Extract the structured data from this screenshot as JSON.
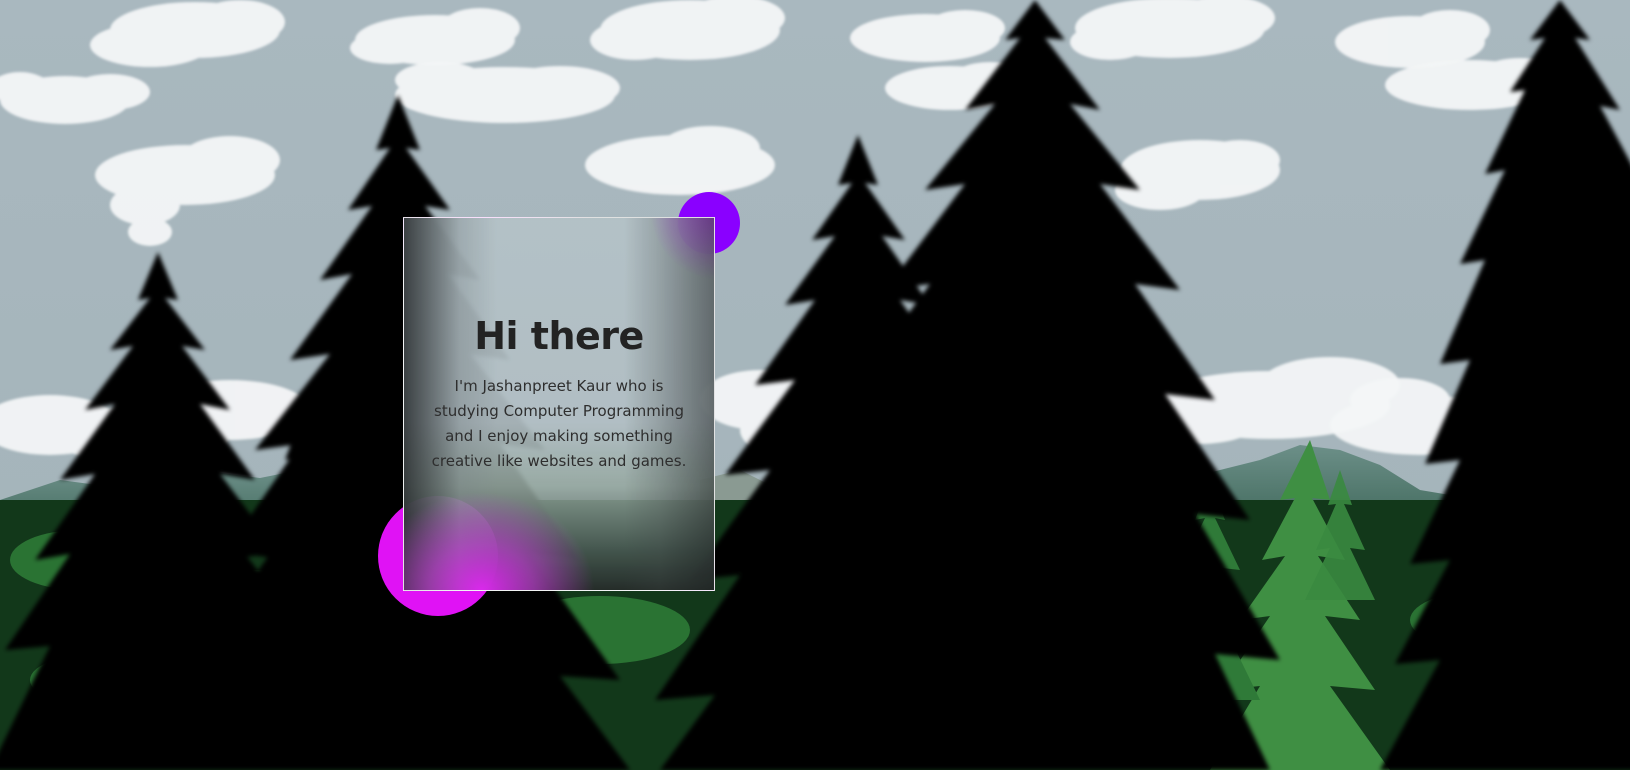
{
  "hero_card": {
    "title": "Hi there",
    "text": "I'm Jashanpreet Kaur who is studying Computer Programming and I enjoy making something creative like websites and games."
  },
  "colors": {
    "sky": "#a7b6bc",
    "tree_silhouette": "#050505",
    "forest_green": "#2f7a38",
    "blob_purple": "#8a00ff",
    "blob_magenta": "#e012f5",
    "text_dark": "#232323"
  }
}
